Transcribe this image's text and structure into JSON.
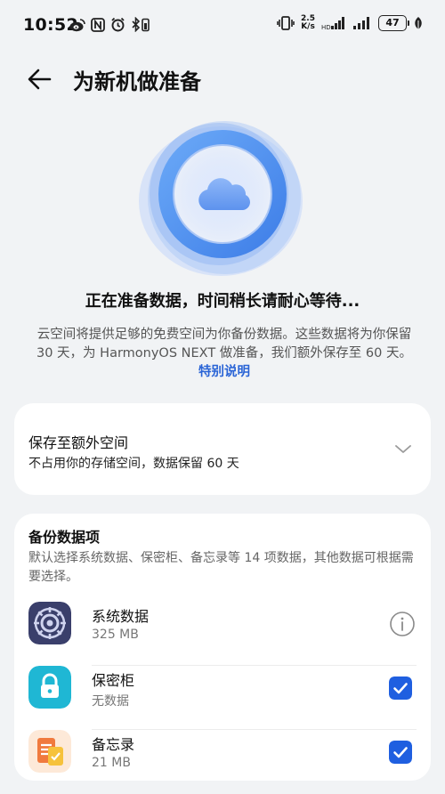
{
  "status_bar": {
    "time": "10:52",
    "net_speed_value": "2.5",
    "net_speed_unit": "K/s",
    "battery": "47",
    "left_icons": [
      "weibo-icon",
      "nfc-icon",
      "alarm-icon",
      "bluetooth-battery-icon"
    ],
    "right_icons": [
      "vibrate-icon",
      "signal-icon",
      "signal-icon",
      "leaf-icon"
    ]
  },
  "title_bar": {
    "title": "为新机做准备",
    "back_icon": "arrow-left-icon"
  },
  "hero": {
    "icon": "cloud-icon",
    "accent": "#4a8df0",
    "heading": "正在准备数据，时间稍长请耐心等待...",
    "desc_text": "云空间将提供足够的免费空间为你备份数据。这些数据将为你保留 30 天，为 HarmonyOS NEXT 做准备，我们额外保存至 60 天。",
    "desc_link": "特别说明",
    "link_color": "#2a64d6"
  },
  "storage_card": {
    "title": "保存至额外空间",
    "subtitle": "不占用你的存储空间，数据保留 60 天",
    "icon": "chevron-down-icon"
  },
  "backup_card": {
    "title": "备份数据项",
    "subtitle": "默认选择系统数据、保密柜、备忘录等 14 项数据，其他数据可根据需要选择。",
    "items": [
      {
        "name": "系统数据",
        "size": "325 MB",
        "icon": "system-data-icon",
        "action": "info-icon",
        "checked": false
      },
      {
        "name": "保密柜",
        "size": "无数据",
        "icon": "safe-lock-icon",
        "action": "checkbox",
        "checked": true
      },
      {
        "name": "备忘录",
        "size": "21 MB",
        "icon": "notes-icon",
        "action": "checkbox",
        "checked": true
      }
    ],
    "check_color": "#1f5fe0"
  }
}
